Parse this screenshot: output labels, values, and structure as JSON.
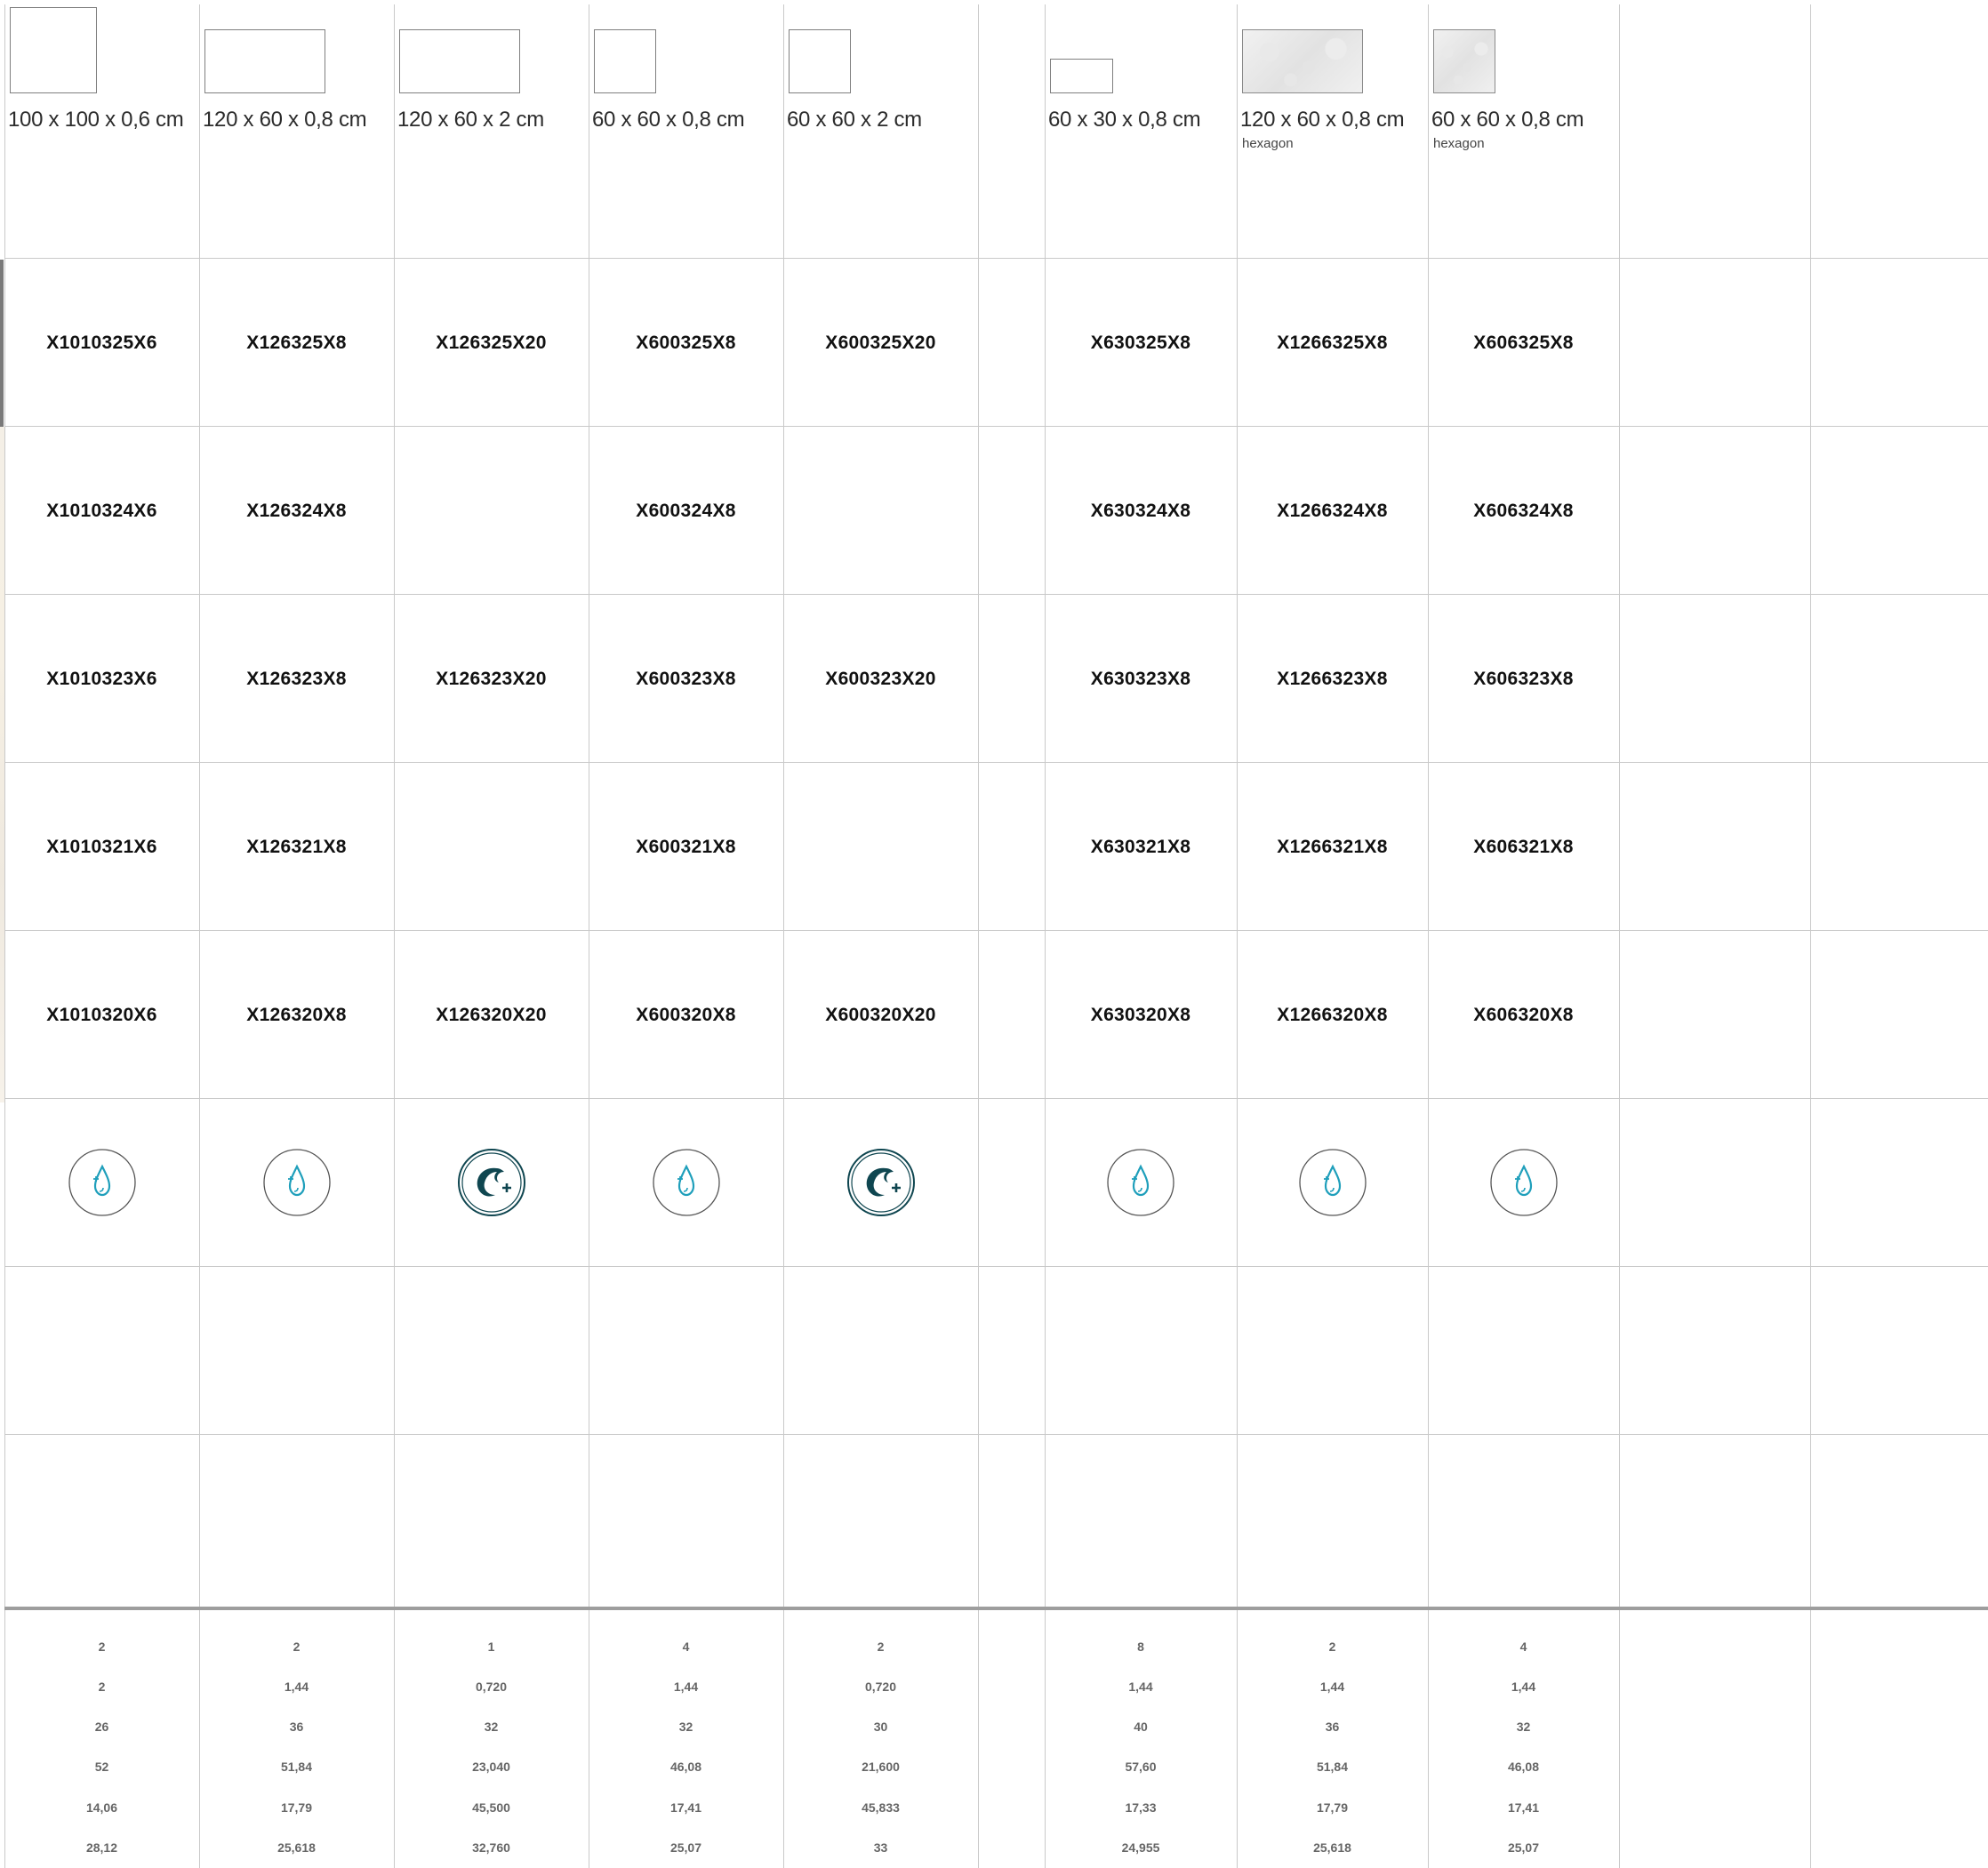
{
  "columns": [
    {
      "size": "100 x 100 x 0,6 cm",
      "note": "",
      "shape": "square-lg",
      "texture": "plain",
      "codes": [
        "X1010325X6",
        "X1010324X6",
        "X1010323X6",
        "X1010321X6",
        "X1010320X6"
      ],
      "icon": "water-drop-icon",
      "stats": [
        "2",
        "2",
        "26",
        "52",
        "14,06",
        "28,12"
      ]
    },
    {
      "size": "120 x 60 x 0,8 cm",
      "note": "",
      "shape": "rect",
      "texture": "plain",
      "codes": [
        "X126325X8",
        "X126324X8",
        "X126323X8",
        "X126321X8",
        "X126320X8"
      ],
      "icon": "water-drop-icon",
      "stats": [
        "2",
        "1,44",
        "36",
        "51,84",
        "17,79",
        "25,618"
      ]
    },
    {
      "size": "120 x 60 x 2 cm",
      "note": "",
      "shape": "rect",
      "texture": "plain",
      "codes": [
        "X126325X20",
        "",
        "X126323X20",
        "",
        "X126320X20"
      ],
      "icon": "outdoor-wave-icon",
      "stats": [
        "1",
        "0,720",
        "32",
        "23,040",
        "45,500",
        "32,760"
      ]
    },
    {
      "size": "60 x 60 x 0,8 cm",
      "note": "",
      "shape": "square",
      "texture": "plain",
      "codes": [
        "X600325X8",
        "X600324X8",
        "X600323X8",
        "X600321X8",
        "X600320X8"
      ],
      "icon": "water-drop-icon",
      "stats": [
        "4",
        "1,44",
        "32",
        "46,08",
        "17,41",
        "25,07"
      ]
    },
    {
      "size": "60 x 60 x 2 cm",
      "note": "",
      "shape": "square",
      "texture": "plain",
      "codes": [
        "X600325X20",
        "",
        "X600323X20",
        "",
        "X600320X20"
      ],
      "icon": "outdoor-wave-icon",
      "stats": [
        "2",
        "0,720",
        "30",
        "21,600",
        "45,833",
        "33"
      ]
    },
    {
      "size": "60 x 30 x 0,8 cm",
      "note": "",
      "shape": "rect-sm",
      "texture": "plain",
      "codes": [
        "X630325X8",
        "X630324X8",
        "X630323X8",
        "X630321X8",
        "X630320X8"
      ],
      "icon": "water-drop-icon",
      "stats": [
        "8",
        "1,44",
        "40",
        "57,60",
        "17,33",
        "24,955"
      ]
    },
    {
      "size": "120 x 60 x 0,8 cm",
      "note": "hexagon",
      "shape": "rect",
      "texture": "marble",
      "codes": [
        "X1266325X8",
        "X1266324X8",
        "X1266323X8",
        "X1266321X8",
        "X1266320X8"
      ],
      "icon": "water-drop-icon",
      "stats": [
        "2",
        "1,44",
        "36",
        "51,84",
        "17,79",
        "25,618"
      ]
    },
    {
      "size": "60 x 60 x 0,8 cm",
      "note": "hexagon",
      "shape": "square",
      "texture": "marble",
      "codes": [
        "X606325X8",
        "X606324X8",
        "X606323X8",
        "X606321X8",
        "X606320X8"
      ],
      "icon": "water-drop-icon",
      "stats": [
        "4",
        "1,44",
        "32",
        "46,08",
        "17,41",
        "25,07"
      ]
    }
  ],
  "colors": {
    "drop": "#1f9fbb",
    "wave_fill": "#0f4650",
    "grid": "#c9c9c9",
    "stat_text": "#666666"
  }
}
